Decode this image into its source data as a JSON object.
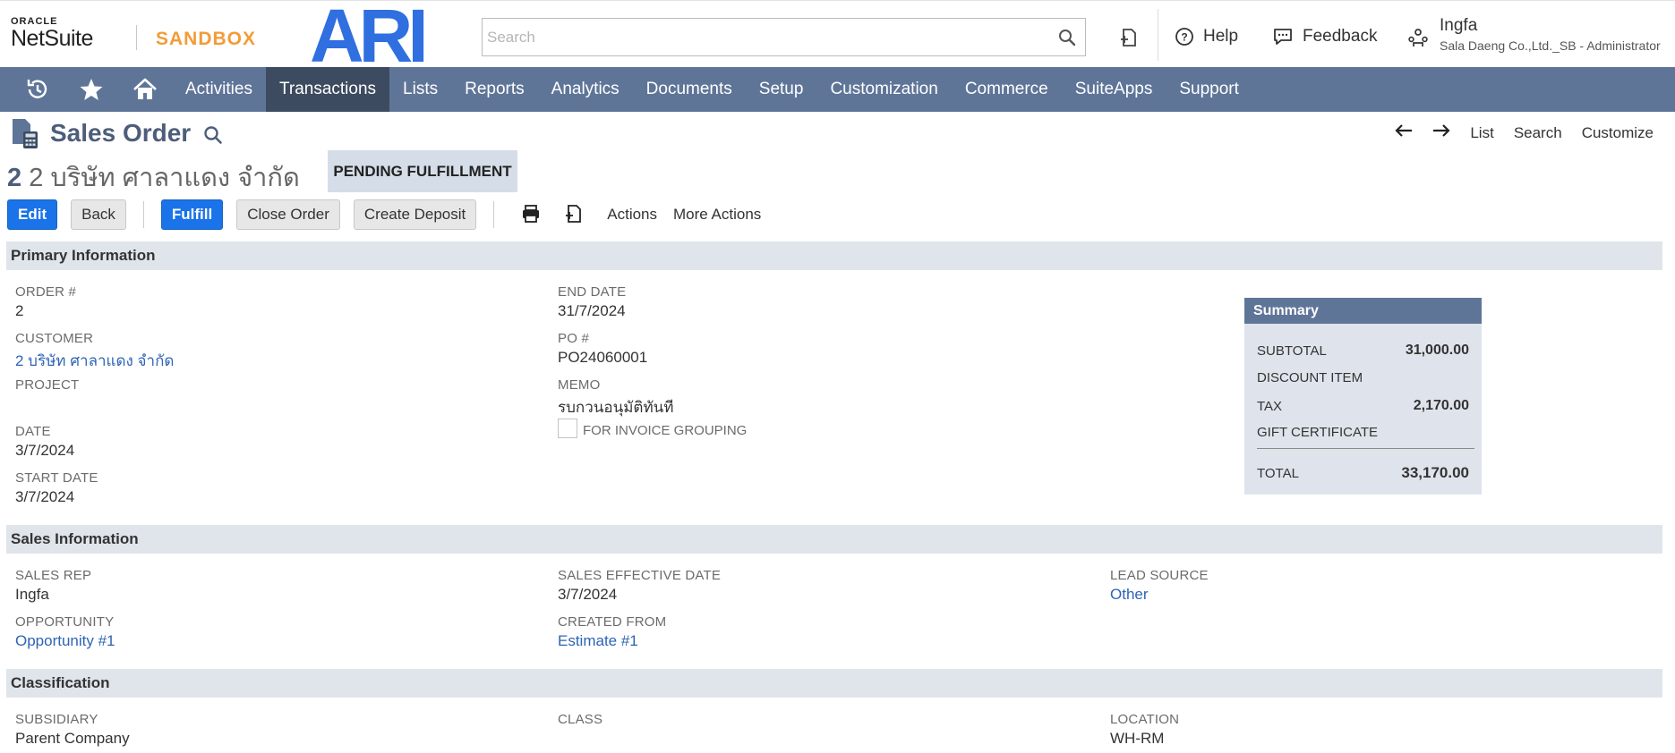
{
  "header": {
    "oracle_text": "ORACLE",
    "netsuite_text": "NetSuite",
    "sandbox_text": "SANDBOX",
    "brand_logo_text": "ARI",
    "search_placeholder": "Search",
    "help_label": "Help",
    "feedback_label": "Feedback",
    "user_name": "Ingfa",
    "user_role": "Sala Daeng Co.,Ltd._SB - Administrator"
  },
  "nav": {
    "items": [
      "Activities",
      "Transactions",
      "Lists",
      "Reports",
      "Analytics",
      "Documents",
      "Setup",
      "Customization",
      "Commerce",
      "SuiteApps",
      "Support"
    ],
    "active": "Transactions"
  },
  "page": {
    "title": "Sales Order",
    "record_number": "2",
    "record_name": "2 บริษัท ศาลาแดง จำกัด",
    "status": "PENDING FULFILLMENT",
    "top_nav": [
      "List",
      "Search",
      "Customize"
    ]
  },
  "buttons": {
    "edit": "Edit",
    "back": "Back",
    "fulfill": "Fulfill",
    "close_order": "Close Order",
    "create_deposit": "Create Deposit",
    "actions": "Actions",
    "more_actions": "More Actions"
  },
  "primary": {
    "section_title": "Primary Information",
    "order_no": {
      "label": "ORDER #",
      "value": "2"
    },
    "customer": {
      "label": "CUSTOMER",
      "value": "2 บริษัท ศาลาแดง จำกัด"
    },
    "project": {
      "label": "PROJECT",
      "value": ""
    },
    "date": {
      "label": "DATE",
      "value": "3/7/2024"
    },
    "start_date": {
      "label": "START DATE",
      "value": "3/7/2024"
    },
    "end_date": {
      "label": "END DATE",
      "value": "31/7/2024"
    },
    "po": {
      "label": "PO #",
      "value": "PO24060001"
    },
    "memo": {
      "label": "MEMO",
      "value": "รบกวนอนุมัติทันที"
    },
    "invoice_grouping": {
      "label": "FOR INVOICE GROUPING",
      "checked": false
    }
  },
  "summary": {
    "title": "Summary",
    "subtotal": {
      "label": "SUBTOTAL",
      "value": "31,000.00"
    },
    "discount": {
      "label": "DISCOUNT ITEM",
      "value": ""
    },
    "tax": {
      "label": "TAX",
      "value": "2,170.00"
    },
    "gift": {
      "label": "GIFT CERTIFICATE",
      "value": ""
    },
    "total": {
      "label": "TOTAL",
      "value": "33,170.00"
    }
  },
  "sales": {
    "section_title": "Sales Information",
    "sales_rep": {
      "label": "SALES REP",
      "value": "Ingfa"
    },
    "opportunity": {
      "label": "OPPORTUNITY",
      "value": "Opportunity #1"
    },
    "sales_effective_date": {
      "label": "SALES EFFECTIVE DATE",
      "value": "3/7/2024"
    },
    "created_from": {
      "label": "CREATED FROM",
      "value": "Estimate #1"
    },
    "lead_source": {
      "label": "LEAD SOURCE",
      "value": "Other"
    }
  },
  "classification": {
    "section_title": "Classification",
    "subsidiary": {
      "label": "SUBSIDIARY",
      "value": "Parent Company"
    },
    "class": {
      "label": "CLASS",
      "value": ""
    },
    "location": {
      "label": "LOCATION",
      "value": "WH-RM"
    }
  },
  "colors": {
    "nav_bg": "#5f7598",
    "nav_active": "#3d4b60",
    "primary_button": "#1a73e8",
    "link": "#2e64b5",
    "sandbox": "#f29c38",
    "brand_logo": "#2f6fe0"
  }
}
